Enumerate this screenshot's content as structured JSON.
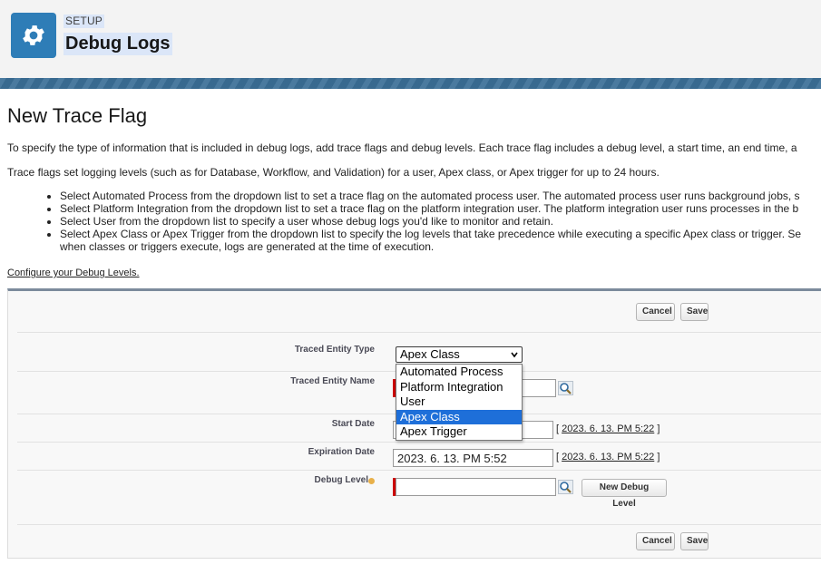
{
  "header": {
    "breadcrumb": "SETUP",
    "title": "Debug Logs",
    "icon": "gear-icon",
    "icon_bg": "#2e7db7"
  },
  "page": {
    "title": "New Trace Flag",
    "intro": "To specify the type of information that is included in debug logs, add trace flags and debug levels. Each trace flag includes a debug level, a start time, an end time, a",
    "info": "Trace flags set logging levels (such as for Database, Workflow, and Validation) for a user, Apex class, or Apex trigger for up to 24 hours.",
    "bullets": [
      "Select Automated Process from the dropdown list to set a trace flag on the automated process user. The automated process user runs background jobs, s",
      "Select Platform Integration from the dropdown list to set a trace flag on the platform integration user. The platform integration user runs processes in the b",
      "Select User from the dropdown list to specify a user whose debug logs you'd like to monitor and retain.",
      "Select Apex Class or Apex Trigger from the dropdown list to specify the log levels that take precedence while executing a specific Apex class or trigger. Se"
    ],
    "bullet4_cont": "when classes or triggers execute, logs are generated at the time of execution.",
    "config_link": "Configure your Debug Levels."
  },
  "form": {
    "cancel_label": "Cancel",
    "save_label": "Save",
    "traced_entity_type_label": "Traced Entity Type",
    "traced_entity_type_value": "Apex Class",
    "traced_entity_type_options": [
      "Automated Process",
      "Platform Integration",
      "User",
      "Apex Class",
      "Apex Trigger"
    ],
    "traced_entity_name_label": "Traced Entity Name",
    "traced_entity_name_value": "",
    "start_date_label": "Start Date",
    "start_date_value": "",
    "start_date_link": "2023. 6. 13. PM 5:22",
    "expiration_date_label": "Expiration Date",
    "expiration_date_value": "2023. 6. 13. PM 5:52",
    "expiration_date_link": "2023. 6. 13. PM 5:22",
    "debug_level_label": "Debug Level",
    "debug_level_value": "",
    "new_debug_level_label": "New Debug Level",
    "bracket_open": "[",
    "bracket_close": "]",
    "required_color": "#cc0000",
    "selected_option_color": "#1e6fd9"
  }
}
